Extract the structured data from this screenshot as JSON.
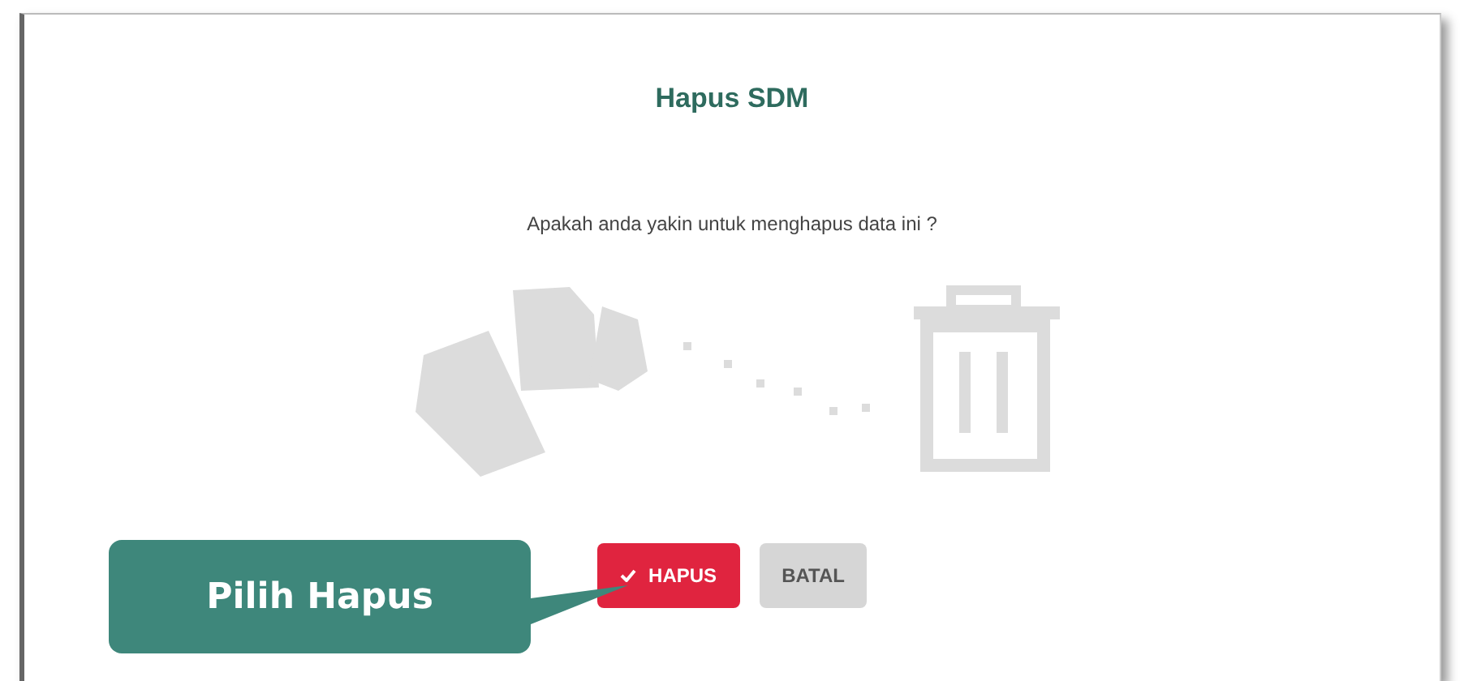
{
  "dialog": {
    "title": "Hapus SDM",
    "message": "Apakah anda yakin untuk menghapus data ini ?",
    "buttons": [
      {
        "label": "HAPUS",
        "kind": "danger"
      },
      {
        "label": "BATAL",
        "kind": "cancel"
      }
    ]
  },
  "callout": {
    "text": "Pilih Hapus"
  }
}
